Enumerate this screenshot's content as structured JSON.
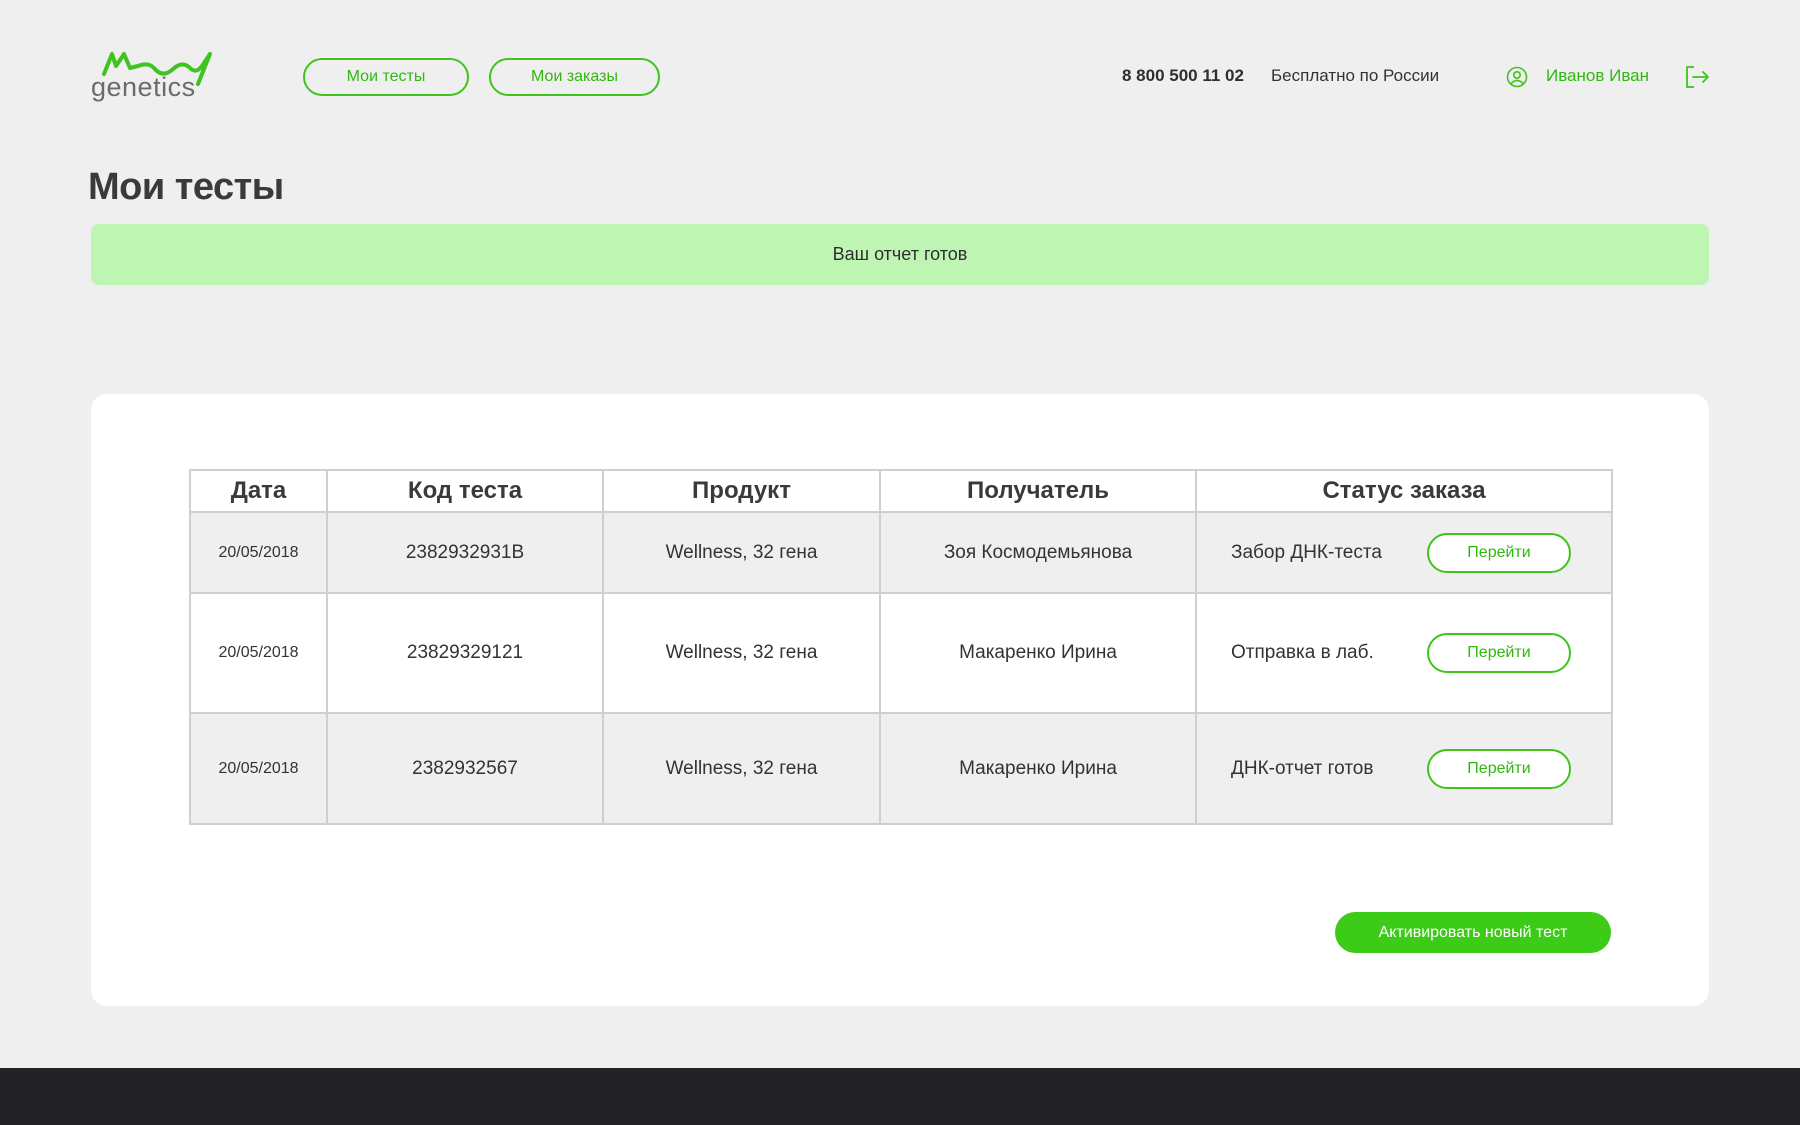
{
  "brand": {
    "logo_word": "genetics",
    "accent_color": "#3ec41e"
  },
  "nav": {
    "items": [
      {
        "label": "Мои тесты"
      },
      {
        "label": "Мои заказы"
      }
    ]
  },
  "header": {
    "phone": "8 800 500 11 02",
    "phone_note": "Бесплатно по России",
    "user_name": "Иванов Иван",
    "user_icon": "user-circle-icon",
    "logout_icon": "logout-icon"
  },
  "page": {
    "title": "Мои тесты",
    "notice": "Ваш отчет готов",
    "notice_color": "#bff5b2"
  },
  "table": {
    "headers": [
      "Дата",
      "Код теста",
      "Продукт",
      "Получатель",
      "Статус заказа"
    ],
    "rows": [
      {
        "date": "20/05/2018",
        "code": "2382932931B",
        "product": "Wellness, 32 гена",
        "recipient": "Зоя Космодемьянова",
        "status": "Забор ДНК-теста",
        "action": "Перейти"
      },
      {
        "date": "20/05/2018",
        "code": "23829329121",
        "product": "Wellness, 32 гена",
        "recipient": "Макаренко Ирина",
        "status": "Отправка в лаб.",
        "action": "Перейти"
      },
      {
        "date": "20/05/2018",
        "code": "2382932567",
        "product": "Wellness, 32 гена",
        "recipient": "Макаренко Ирина",
        "status": "ДНК-отчет готов",
        "action": "Перейти"
      }
    ]
  },
  "actions": {
    "activate_label": "Активировать новый тест"
  }
}
